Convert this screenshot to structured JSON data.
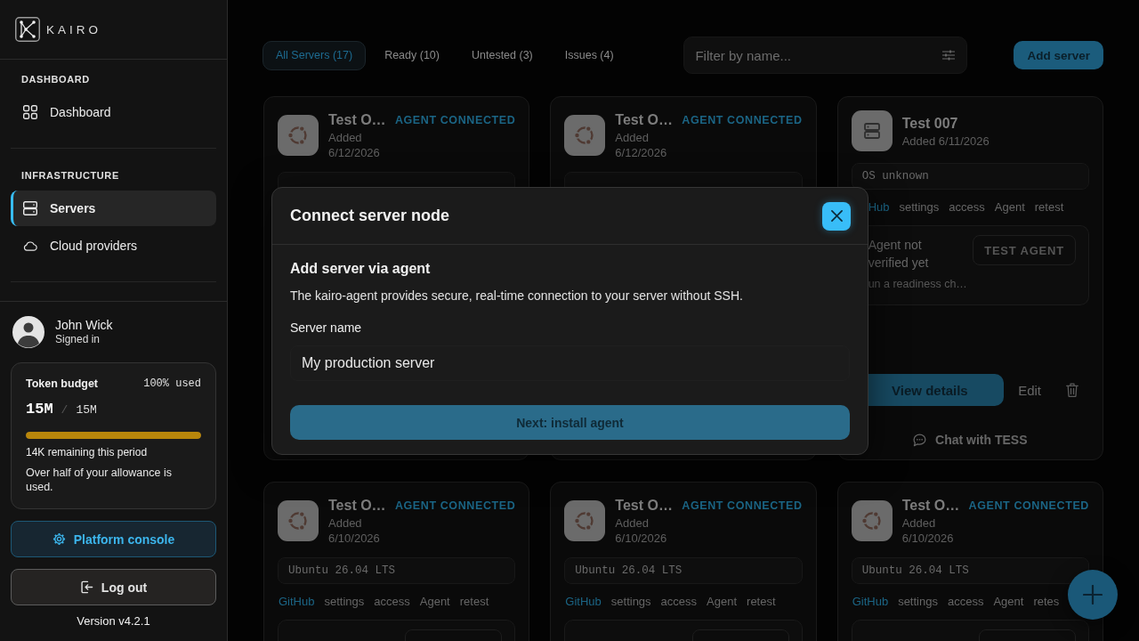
{
  "sidebar": {
    "logo": "KAIRO",
    "sections": [
      {
        "heading": "DASHBOARD",
        "items": [
          {
            "label": "Dashboard",
            "kind": "dashboard",
            "selected": false
          }
        ]
      },
      {
        "heading": "INFRASTRUCTURE",
        "items": [
          {
            "label": "Servers",
            "kind": "servers",
            "selected": true
          },
          {
            "label": "Cloud providers",
            "kind": "cloud",
            "selected": false
          }
        ]
      }
    ],
    "user": {
      "name": "John Wick",
      "status": "Signed in"
    },
    "token_budget": {
      "title": "Token budget",
      "usage": "100% used",
      "used": "15M",
      "separator": "/",
      "total": "15M",
      "level": 1,
      "remaining": "14K remaining this period",
      "note": "Over half of your allowance is used."
    },
    "buttons": [
      {
        "label": "Platform console",
        "kind": "console"
      },
      {
        "label": "Log out",
        "kind": "logout"
      }
    ],
    "version": "Version v4.2.1"
  },
  "filters": [
    {
      "label": "All Servers (17)",
      "selected": true
    },
    {
      "label": "Ready (10)",
      "selected": false
    },
    {
      "label": "Untested (3)",
      "selected": false
    },
    {
      "label": "Issues (4)",
      "selected": false
    }
  ],
  "search": {
    "placeholder": "Filter by name..."
  },
  "add_button": "Add server",
  "servers": [
    {
      "kind": "ubuntu",
      "title": "Test O…",
      "added": "Added 6/12/2026",
      "badge": "AGENT CONNECTED"
    },
    {
      "kind": "ubuntu",
      "title": "Test O…",
      "added": "Added 6/12/2026",
      "badge": "AGENT CONNECTED"
    },
    {
      "kind": "generic",
      "title": "Test 007",
      "added": "Added 6/11/2026",
      "os": "OS unknown",
      "tags": [
        {
          "label": "Hub",
          "selected": true
        },
        {
          "label": "settings",
          "selected": false
        },
        {
          "label": "access",
          "selected": false
        },
        {
          "label": "Agent",
          "selected": false
        },
        {
          "label": "retest",
          "selected": false
        }
      ],
      "status": {
        "title": "Agent not verified yet",
        "detail": "un a readiness ch…",
        "button": "TEST AGENT"
      },
      "primary_button": "View details",
      "secondary_button": "Edit",
      "chat": "Chat with TESS"
    },
    {
      "kind": "ubuntu",
      "title": "Test O…",
      "added": "Added 6/10/2026",
      "badge": "AGENT CONNECTED",
      "os": "Ubuntu 26.04 LTS",
      "tags": [
        {
          "label": "GitHub",
          "selected": true
        },
        {
          "label": "settings",
          "selected": false
        },
        {
          "label": "access",
          "selected": false
        },
        {
          "label": "Agent",
          "selected": false
        },
        {
          "label": "retest",
          "selected": false
        }
      ]
    },
    {
      "kind": "ubuntu",
      "title": "Test O…",
      "added": "Added 6/10/2026",
      "badge": "AGENT CONNECTED",
      "os": "Ubuntu 26.04 LTS",
      "tags": [
        {
          "label": "GitHub",
          "selected": true
        },
        {
          "label": "settings",
          "selected": false
        },
        {
          "label": "access",
          "selected": false
        },
        {
          "label": "Agent",
          "selected": false
        },
        {
          "label": "retest",
          "selected": false
        }
      ]
    },
    {
      "kind": "ubuntu",
      "title": "Test O…",
      "added": "Added 6/10/2026",
      "badge": "AGENT CONNECTED",
      "os": "Ubuntu 26.04 LTS",
      "tags": [
        {
          "label": "GitHub",
          "selected": true
        },
        {
          "label": "settings",
          "selected": false
        },
        {
          "label": "access",
          "selected": false
        },
        {
          "label": "Agent",
          "selected": false
        },
        {
          "label": "retes",
          "selected": false
        }
      ]
    }
  ],
  "modal": {
    "title": "Connect server node",
    "heading": "Add server via agent",
    "description": "The kairo-agent provides secure, real-time connection to your server without SSH.",
    "field": {
      "label": "Server name",
      "value": "My production server"
    },
    "submit": "Next: install agent"
  }
}
